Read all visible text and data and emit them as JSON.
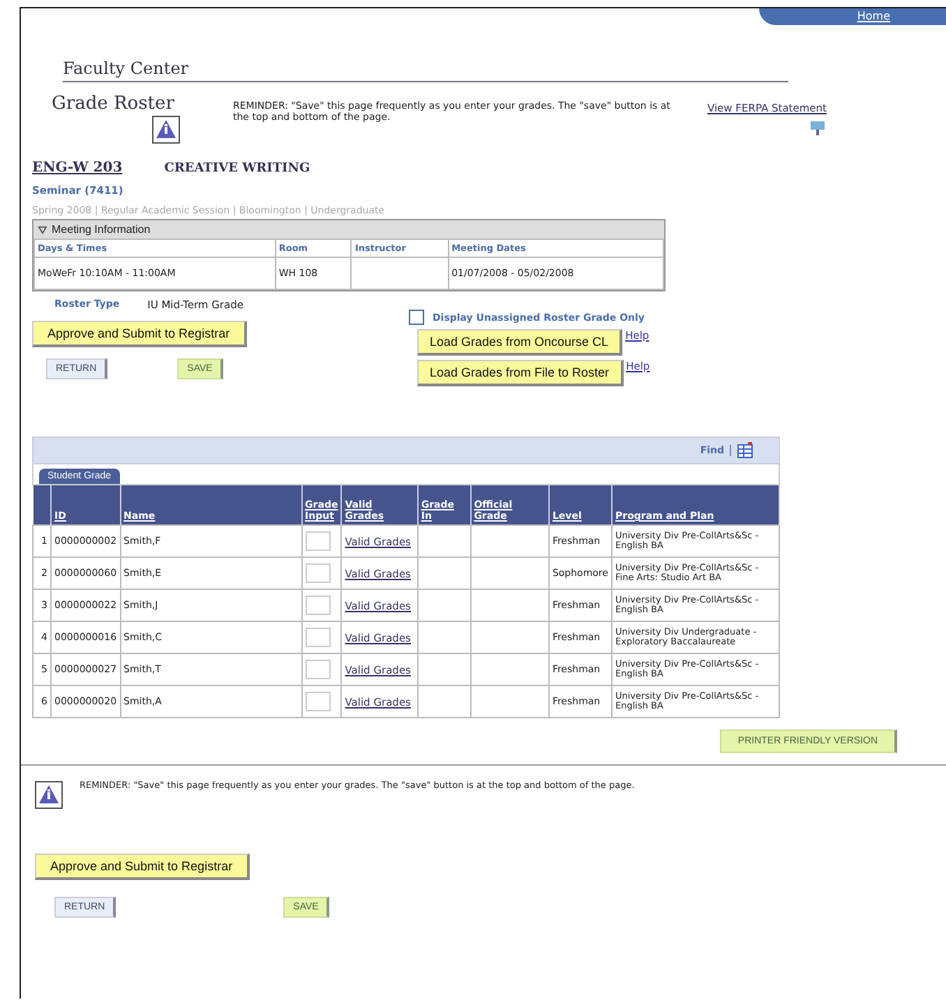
{
  "top_link": "Home",
  "page_title": "Faculty Center",
  "section_title": "Grade Roster",
  "reminder": "REMINDER:  \"Save\" this page frequently as you enter your grades.  The \"save\" button is at the top and bottom of the page.",
  "ferpa_link": "View FERPA Statement",
  "course": {
    "code": "ENG-W 203",
    "title": "CREATIVE WRITING",
    "section": "Seminar (7411)",
    "term": "Spring 2008 | Regular Academic Session | Bloomington | Undergraduate"
  },
  "meeting": {
    "title": "Meeting Information",
    "expanded": true,
    "columns": [
      "Days & Times",
      "Room",
      "Instructor",
      "Meeting Dates"
    ],
    "rows": [
      [
        "MoWeFr 10:10AM - 11:00AM",
        "WH 108",
        "",
        "01/07/2008 - 05/02/2008"
      ]
    ]
  },
  "roster_type": {
    "label": "Roster Type",
    "value": "IU Mid-Term Grade"
  },
  "unassigned": {
    "label": "Display Unassigned Roster Grade Only",
    "checked": false
  },
  "approve_button": "Approve and Submit to Registrar",
  "return_button": "RETURN",
  "save_button": "SAVE",
  "load_buttons": [
    {
      "label": "Load Grades from Oncourse CL",
      "help": "Help"
    },
    {
      "label": "Load Grades from File to Roster",
      "help": "Help"
    }
  ],
  "grid": {
    "find": "Find",
    "tabs": [
      {
        "label": "Student Grade",
        "selected": true
      }
    ],
    "columns": [
      "",
      "ID",
      "Name",
      "Grade Input",
      "Valid Grades",
      "Grade In",
      "Official Grade",
      "Level",
      "Program and Plan"
    ],
    "rows": [
      {
        "num": "1",
        "id": "0000000002",
        "name": "Smith,F",
        "valid": "Valid Grades",
        "level": "Freshman",
        "plan": "University Div Pre-CollArts&Sc - English BA"
      },
      {
        "num": "2",
        "id": "0000000060",
        "name": "Smith,E",
        "valid": "Valid Grades",
        "level": "Sophomore",
        "plan": "University Div Pre-CollArts&Sc - Fine Arts: Studio Art BA"
      },
      {
        "num": "3",
        "id": "0000000022",
        "name": "Smith,J",
        "valid": "Valid Grades",
        "level": "Freshman",
        "plan": "University Div Pre-CollArts&Sc - English BA"
      },
      {
        "num": "4",
        "id": "0000000016",
        "name": "Smith,C",
        "valid": "Valid Grades",
        "level": "Freshman",
        "plan": "University Div Undergraduate - Exploratory Baccalaureate"
      },
      {
        "num": "5",
        "id": "0000000027",
        "name": "Smith,T",
        "valid": "Valid Grades",
        "level": "Freshman",
        "plan": "University Div Pre-CollArts&Sc - English BA"
      },
      {
        "num": "6",
        "id": "0000000020",
        "name": "Smith,A",
        "valid": "Valid Grades",
        "level": "Freshman",
        "plan": "University Div Pre-CollArts&Sc - English BA"
      }
    ]
  },
  "printer_button": "PRINTER FRIENDLY VERSION",
  "bottom": {
    "reminder": "REMINDER:  \"Save\" this page frequently as you enter your grades.  The \"save\" button is at the top and bottom of the page.",
    "approve_button": "Approve and Submit to Registrar",
    "return_button": "RETURN",
    "save_button": "SAVE"
  }
}
